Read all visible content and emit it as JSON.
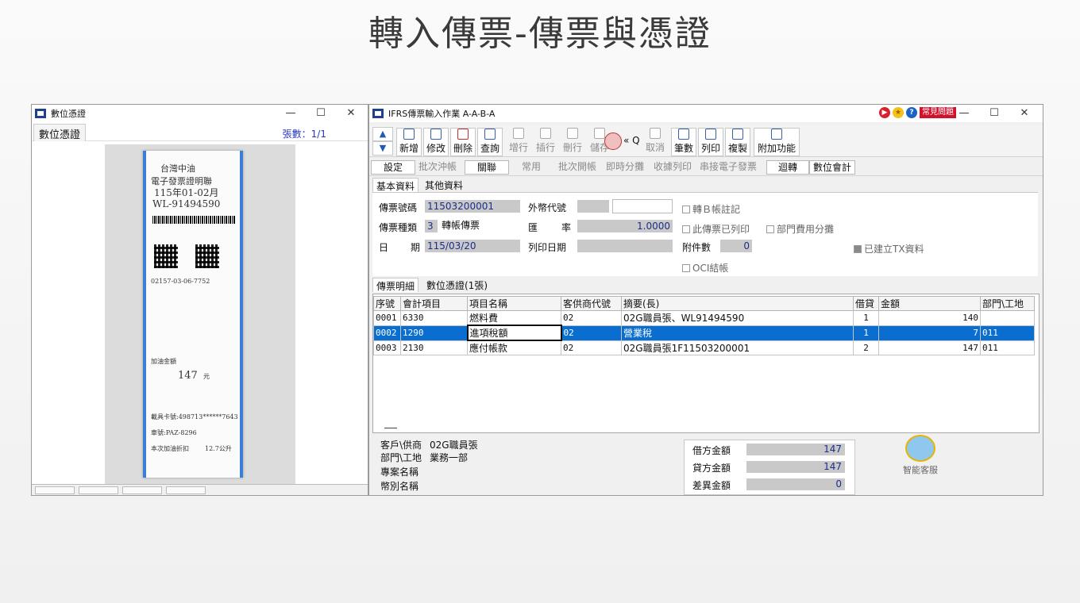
{
  "slide_title": "轉入傳票-傳票與憑證",
  "left_window": {
    "title": "數位憑證",
    "tab": "數位憑證",
    "count_label": "張數：1/1",
    "receipt_lines": [
      "台灣中油",
      "電子發票證明聯",
      "115年01-02月",
      "WL-91494590",
      "02157-03-06-7752",
      "加油金額",
      "147",
      "元",
      "載具卡號:498713******7643",
      "車號:PAZ-8296",
      "本次加油折扣",
      "12.7公升"
    ]
  },
  "right_window": {
    "title": "IFRS傳票輸入作業  A-A-B-A",
    "help_label": "常見問題",
    "toolbar": {
      "up": "▲",
      "down": "▼",
      "buttons": [
        "新增",
        "修改",
        "刪除",
        "查詢",
        "增行",
        "插行",
        "刪行",
        "儲存",
        "取消",
        "筆數",
        "列印",
        "複製",
        "附加功能"
      ],
      "mini_tools": "« Q"
    },
    "actionbar": [
      "設定",
      "批次沖帳",
      "關聯",
      "常用",
      "批次開帳",
      "即時分攤",
      "收據列印",
      "串接電子發票",
      "迴轉",
      "數位會計"
    ],
    "tabs": [
      "基本資料",
      "其他資料"
    ],
    "form": {
      "voucher_no_label": "傳票號碼",
      "voucher_no": "11503200001",
      "foreign_code_label": "外幣代號",
      "foreign_code": "",
      "foreign_extra": "",
      "transfer_b_label": "轉Ｂ帳註記",
      "voucher_type_label": "傳票種類",
      "voucher_type_code": "3",
      "voucher_type_name": "轉帳傳票",
      "rate_label_1": "匯",
      "rate_label_2": "率",
      "rate": "1.0000",
      "printed_label": "此傳票已列印",
      "dept_split_label": "部門費用分攤",
      "date_label_1": "日",
      "date_label_2": "期",
      "date": "115/03/20",
      "print_date_label": "列印日期",
      "print_date": "",
      "attach_label": "附件數",
      "attach_count": "0",
      "tx_label": "已建立TX資料",
      "oci_label": "OCI結帳"
    },
    "detail_tabs": [
      "傳票明細",
      "數位憑證(1張)"
    ],
    "grid": {
      "headers": [
        "序號",
        "會計項目",
        "項目名稱",
        "客供商代號",
        "摘要(長)",
        "借貸",
        "金額",
        "部門\\工地"
      ],
      "rows": [
        [
          "0001",
          "6330",
          "燃料費",
          "02",
          "02G職員張、WL91494590",
          "1",
          "140",
          ""
        ],
        [
          "0002",
          "1290",
          "進項稅額",
          "02",
          "營業稅",
          "1",
          "7",
          "011"
        ],
        [
          "0003",
          "2130",
          "應付帳款",
          "02",
          "02G職員張1F11503200001",
          "2",
          "147",
          "011"
        ]
      ]
    },
    "footer": {
      "customer_label": "客戶\\供商",
      "customer": "02G職員張",
      "dept_label": "部門\\工地",
      "dept": "業務一部",
      "project_label": "專案名稱",
      "currency_label": "幣別名稱",
      "debit_label": "借方金額",
      "debit": "147",
      "credit_label": "貸方金額",
      "credit": "147",
      "diff_label": "差異金額",
      "diff": "0",
      "bot_label": "智能客服"
    }
  }
}
